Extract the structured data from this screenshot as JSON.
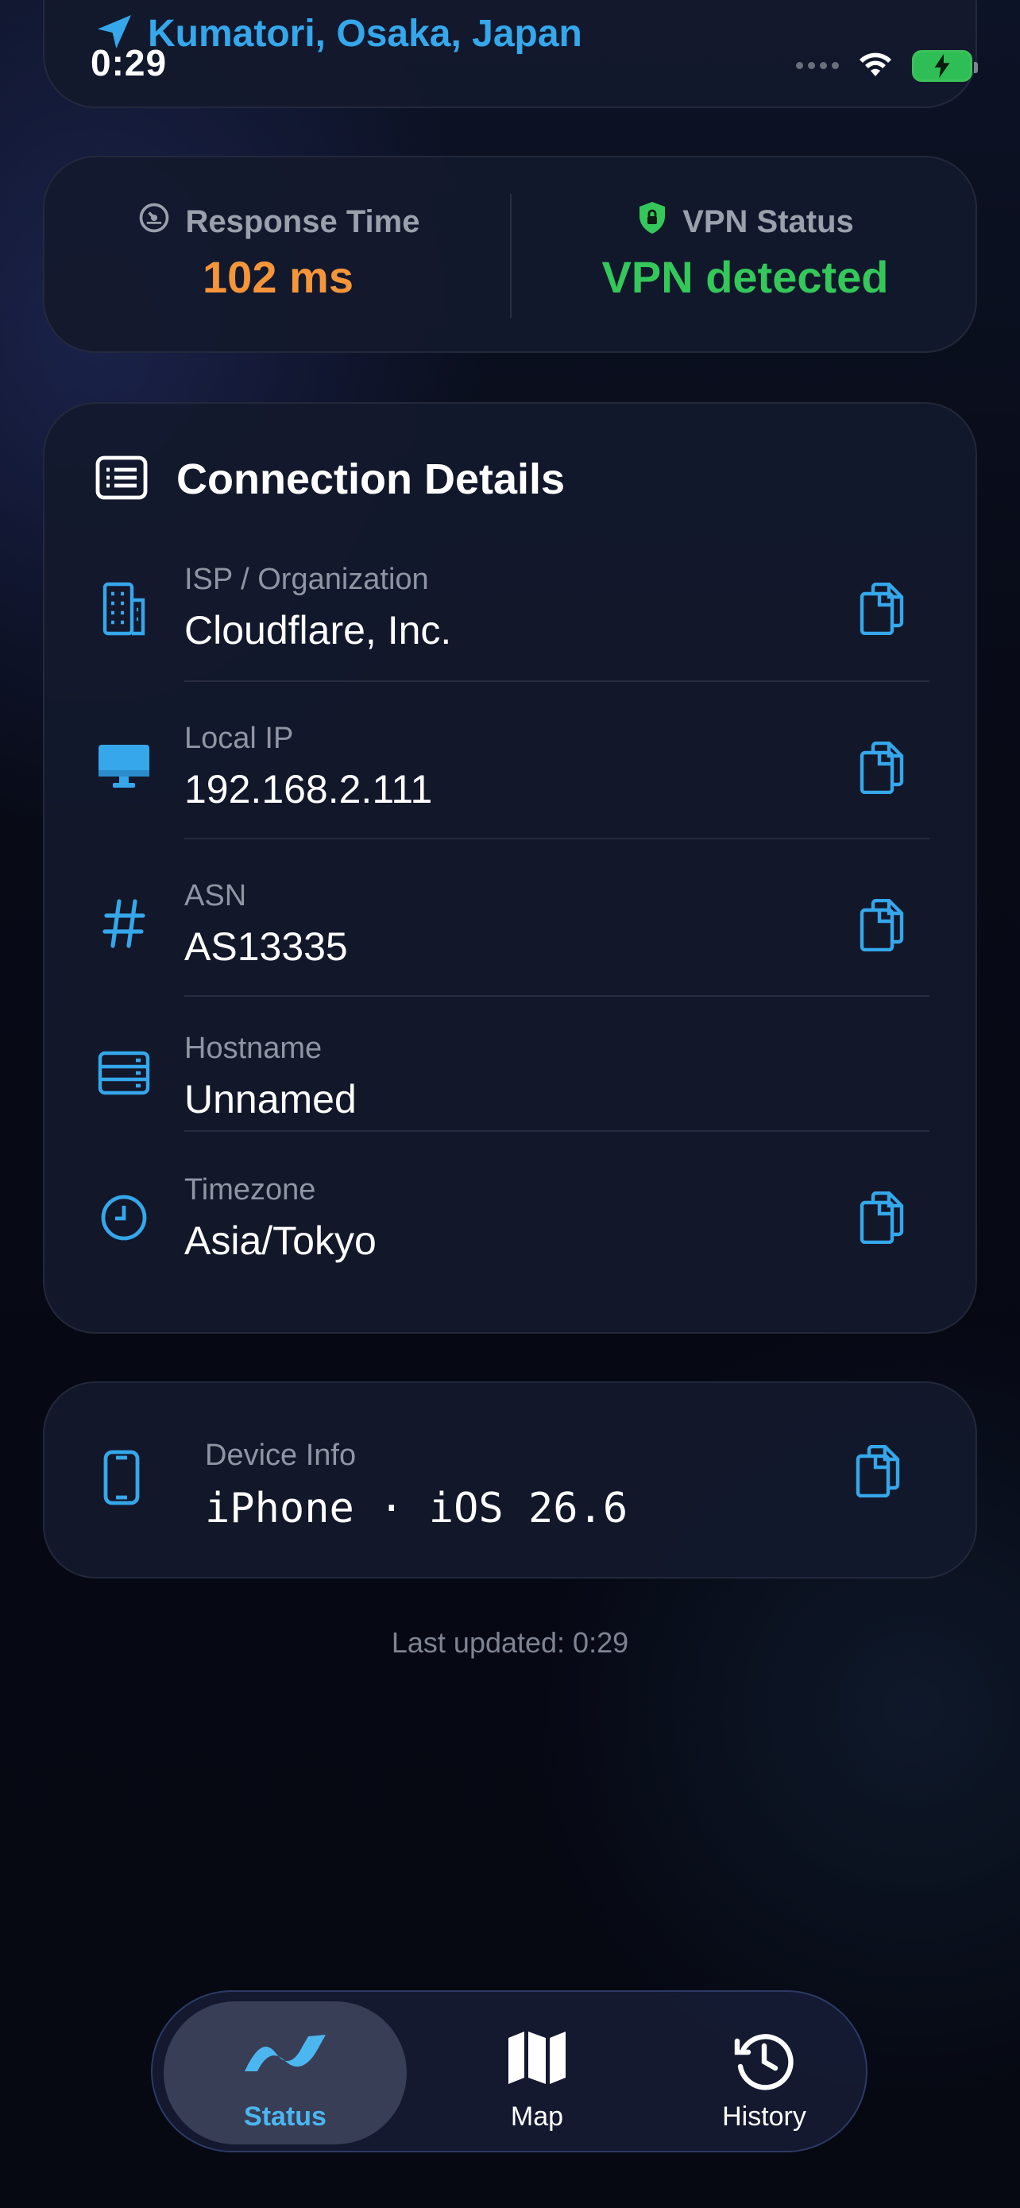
{
  "status_bar": {
    "time": "0:29"
  },
  "location": {
    "text": "Kumatori, Osaka, Japan"
  },
  "metrics": {
    "response_time": {
      "label": "Response Time",
      "value": "102 ms"
    },
    "vpn_status": {
      "label": "VPN Status",
      "value": "VPN detected"
    }
  },
  "details": {
    "title": "Connection Details",
    "rows": [
      {
        "label": "ISP / Organization",
        "value": "Cloudflare, Inc.",
        "icon": "building-icon",
        "copyable": true
      },
      {
        "label": "Local IP",
        "value": "192.168.2.111",
        "icon": "desktop-icon",
        "copyable": true
      },
      {
        "label": "ASN",
        "value": "AS13335",
        "icon": "hash-icon",
        "copyable": true
      },
      {
        "label": "Hostname",
        "value": "Unnamed",
        "icon": "server-icon",
        "copyable": false
      },
      {
        "label": "Timezone",
        "value": "Asia/Tokyo",
        "icon": "clock-icon",
        "copyable": true
      }
    ]
  },
  "device": {
    "label": "Device Info",
    "value": "iPhone · iOS 26.6"
  },
  "last_updated": "Last updated: 0:29",
  "tabs": [
    {
      "label": "Status",
      "icon": "waveform-icon",
      "active": true
    },
    {
      "label": "Map",
      "icon": "map-icon",
      "active": false
    },
    {
      "label": "History",
      "icon": "history-icon",
      "active": false
    }
  ],
  "colors": {
    "accent": "#35a7ea",
    "orange": "#f5953a",
    "green": "#34c759",
    "tab_active": "#4cb6f0"
  }
}
